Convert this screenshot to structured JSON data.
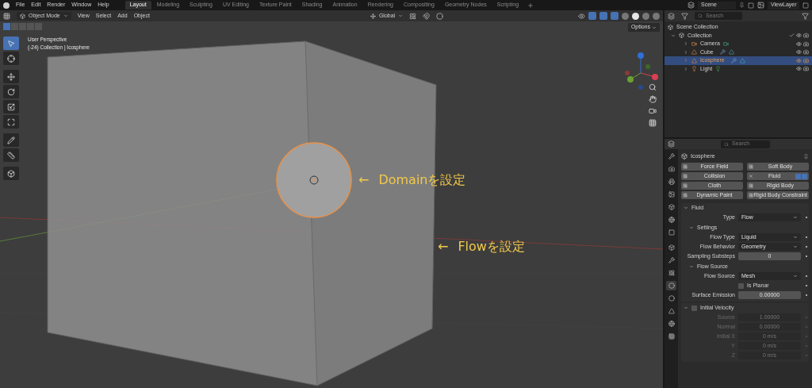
{
  "menu": [
    "File",
    "Edit",
    "Render",
    "Window",
    "Help"
  ],
  "workspaces": [
    {
      "label": "Layout",
      "selected": true
    },
    {
      "label": "Modeling",
      "selected": false
    },
    {
      "label": "Sculpting",
      "selected": false
    },
    {
      "label": "UV Editing",
      "selected": false
    },
    {
      "label": "Texture Paint",
      "selected": false
    },
    {
      "label": "Shading",
      "selected": false
    },
    {
      "label": "Animation",
      "selected": false
    },
    {
      "label": "Rendering",
      "selected": false
    },
    {
      "label": "Compositing",
      "selected": false
    },
    {
      "label": "Geometry Nodes",
      "selected": false
    },
    {
      "label": "Scripting",
      "selected": false
    }
  ],
  "scene": "Scene",
  "view_layer": "ViewLayer",
  "header": {
    "mode": "Object Mode",
    "menus": [
      "View",
      "Select",
      "Add",
      "Object"
    ],
    "orientation": "Global",
    "options": "Options"
  },
  "viewport": {
    "info": [
      "User Perspective",
      "(-24) Collection | Icosphere"
    ],
    "annotations": [
      {
        "arrow": "←",
        "text": "Domainを設定"
      },
      {
        "arrow": "←",
        "text": "Flowを設定"
      }
    ]
  },
  "outliner": {
    "search": {
      "placeholder": "Search"
    },
    "root": "Scene Collection",
    "collection": {
      "label": "Collection",
      "expanded": true,
      "children": [
        {
          "label": "Camera",
          "kind": "camera",
          "selected": false
        },
        {
          "label": "Cube",
          "kind": "mesh",
          "selected": false
        },
        {
          "label": "Icosphere",
          "kind": "mesh",
          "selected": true
        },
        {
          "label": "Light",
          "kind": "light",
          "selected": false
        }
      ]
    }
  },
  "properties": {
    "search": {
      "placeholder": "Search"
    },
    "tabs": [
      {
        "selected": false
      },
      {
        "selected": false
      },
      {
        "selected": false
      },
      {
        "selected": false
      },
      {
        "selected": false
      },
      {
        "selected": false
      },
      {
        "selected": false
      },
      {
        "selected": false
      },
      {
        "selected": false
      },
      {
        "selected": false
      },
      {
        "selected": true
      },
      {
        "selected": false
      },
      {
        "selected": false
      },
      {
        "selected": false
      },
      {
        "selected": false
      }
    ],
    "object": "Icosphere",
    "physics": [
      {
        "label": "Force Field",
        "added": false
      },
      {
        "label": "Soft Body",
        "added": false
      },
      {
        "label": "Collision",
        "added": false
      },
      {
        "label": "Fluid",
        "added": true
      },
      {
        "label": "Cloth",
        "added": false
      },
      {
        "label": "Rigid Body",
        "added": false
      },
      {
        "label": "Dynamic Paint",
        "added": false
      },
      {
        "label": "Rigid Body Constraint",
        "added": false
      }
    ],
    "panels": [
      {
        "title": "Fluid",
        "kind": "panel",
        "disabled": false,
        "rows": [
          {
            "kind": "dropdown",
            "label": "Type",
            "value": "Flow"
          }
        ]
      },
      {
        "title": "Settings",
        "kind": "subpanel",
        "disabled": false,
        "rows": [
          {
            "kind": "dropdown",
            "label": "Flow Type",
            "value": "Liquid"
          },
          {
            "kind": "dropdown",
            "label": "Flow Behavior",
            "value": "Geometry"
          },
          {
            "kind": "number",
            "label": "Sampling Substeps",
            "value": "0"
          }
        ]
      },
      {
        "title": "Flow Source",
        "kind": "subpanel",
        "disabled": false,
        "rows": [
          {
            "kind": "dropdown",
            "label": "Flow Source",
            "value": "Mesh"
          },
          {
            "kind": "checkbox",
            "label": "Is Planar",
            "checked": false
          },
          {
            "kind": "number",
            "label": "Surface Emission",
            "value": "0.00000"
          }
        ]
      },
      {
        "title": "Initial Velocity",
        "kind": "panel",
        "checked": false,
        "disabled": true,
        "rows": [
          {
            "kind": "number",
            "label": "Source",
            "value": "1.00000"
          },
          {
            "kind": "number",
            "label": "Normal",
            "value": "0.00000"
          },
          {
            "kind": "number",
            "label": "Initial X",
            "value": "0 m/s"
          },
          {
            "kind": "number",
            "label": "Y",
            "value": "0 m/s"
          },
          {
            "kind": "number",
            "label": "Z",
            "value": "0 m/s"
          }
        ]
      }
    ]
  }
}
